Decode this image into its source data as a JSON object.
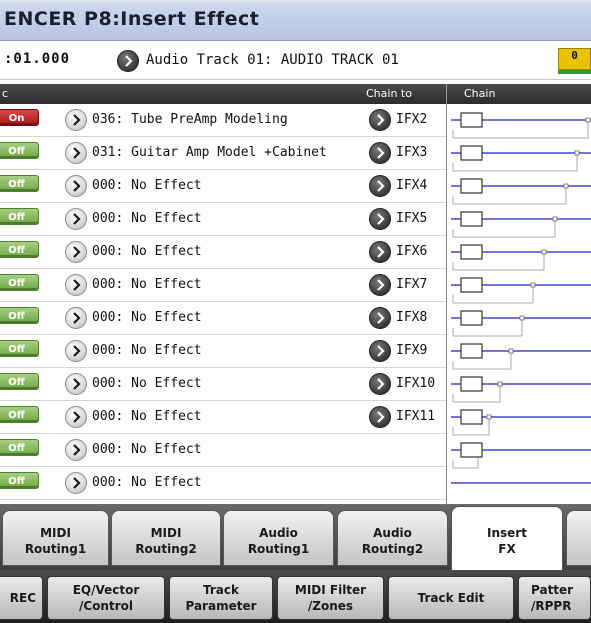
{
  "title": "ENCER P8:Insert Effect",
  "info": {
    "location": ":01.000",
    "track_name": "Audio Track 01: AUDIO TRACK 01",
    "meter_value": "0"
  },
  "columns": {
    "chain_to": "Chain to",
    "chain": "Chain",
    "first": "c"
  },
  "rows": [
    {
      "state": "On",
      "effect": "036: Tube PreAmp Modeling",
      "chain_to": "IFX2"
    },
    {
      "state": "Off",
      "effect": "031: Guitar Amp Model +Cabinet",
      "chain_to": "IFX3"
    },
    {
      "state": "Off",
      "effect": "000: No Effect",
      "chain_to": "IFX4"
    },
    {
      "state": "Off",
      "effect": "000: No Effect",
      "chain_to": "IFX5"
    },
    {
      "state": "Off",
      "effect": "000: No Effect",
      "chain_to": "IFX6"
    },
    {
      "state": "Off",
      "effect": "000: No Effect",
      "chain_to": "IFX7"
    },
    {
      "state": "Off",
      "effect": "000: No Effect",
      "chain_to": "IFX8"
    },
    {
      "state": "Off",
      "effect": "000: No Effect",
      "chain_to": "IFX9"
    },
    {
      "state": "Off",
      "effect": "000: No Effect",
      "chain_to": "IFX10"
    },
    {
      "state": "Off",
      "effect": "000: No Effect",
      "chain_to": "IFX11"
    },
    {
      "state": "Off",
      "effect": "000: No Effect",
      "chain_to": ""
    },
    {
      "state": "Off",
      "effect": "000: No Effect",
      "chain_to": ""
    }
  ],
  "tabs_top": [
    {
      "label": "MIDI\nRouting1",
      "active": false
    },
    {
      "label": "MIDI\nRouting2",
      "active": false
    },
    {
      "label": "Audio\nRouting1",
      "active": false
    },
    {
      "label": "Audio\nRouting2",
      "active": false
    },
    {
      "label": "Insert\nFX",
      "active": true
    }
  ],
  "tabs_bottom": [
    {
      "label": "REC"
    },
    {
      "label": "EQ/Vector\n/Control"
    },
    {
      "label": "Track\nParameter"
    },
    {
      "label": "MIDI Filter\n/Zones"
    },
    {
      "label": "Track Edit"
    },
    {
      "label": "Patter\n/RPPR"
    }
  ],
  "colors": {
    "on_button": "#c02020",
    "off_button": "#7fb650",
    "chain_line": "#2222cc",
    "meter": "#e9c200"
  }
}
